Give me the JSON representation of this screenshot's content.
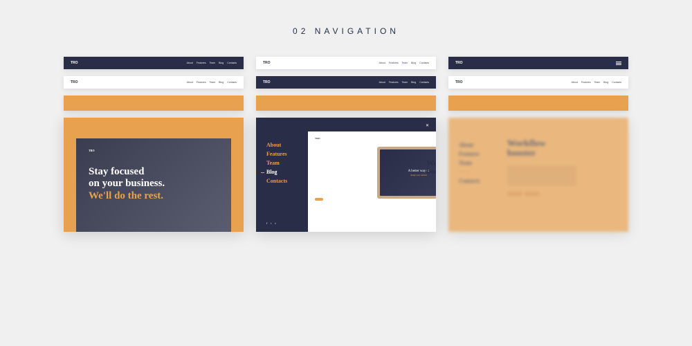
{
  "title": "02 NAVIGATION",
  "brand": "TRO",
  "nav": [
    "About",
    "Features",
    "Team",
    "Blog",
    "Contacts"
  ],
  "hero1": {
    "line1": "Stay focused",
    "line2": "on your business.",
    "line3": "We'll do the rest."
  },
  "hero2": {
    "menu": [
      "About",
      "Features",
      "Team",
      "Blog",
      "Contacts"
    ],
    "screen_line1": "A better way to",
    "screen_line2": "design your website",
    "label_line1": "Workfl",
    "label_line2": "booste"
  },
  "hero3": {
    "menu": [
      "About",
      "Features",
      "Team",
      "Blog",
      "Contacts"
    ],
    "title_line1": "Workflow",
    "title_line2": "booster"
  }
}
